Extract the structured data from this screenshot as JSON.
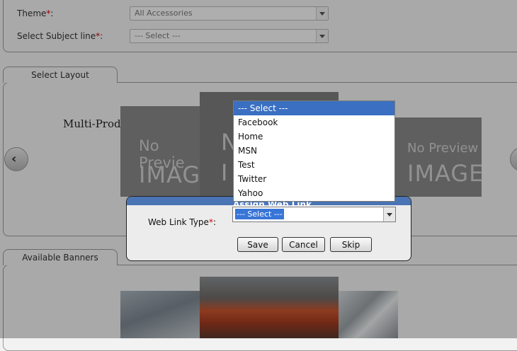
{
  "form": {
    "theme_label": "Theme",
    "theme_value": "All Accessories",
    "subject_label": "Select Subject line",
    "subject_value": "--- Select ---",
    "required_mark": "*",
    "colon": ":"
  },
  "layout_section": {
    "tab_label": "Select Layout",
    "slide_caption": "Multi-Produ",
    "no_preview_line1": "No Previe",
    "no_preview_line2": "IMAG",
    "center_partial_line1": "N",
    "center_partial_line2": "I",
    "right_line1": "No Preview",
    "right_line2": "IMAGE",
    "prev_glyph": "‹"
  },
  "banners_section": {
    "tab_label": "Available Banners"
  },
  "dialog": {
    "title": "Assign Web Link",
    "field_label": "Web Link Type",
    "required_mark": "*",
    "colon": ":",
    "select_value": "--- Select ---",
    "buttons": {
      "save": "Save",
      "cancel": "Cancel",
      "skip": "Skip"
    }
  },
  "dropdown": {
    "options": [
      "--- Select ---",
      "Facebook",
      "Home",
      "MSN",
      "Test",
      "Twitter",
      "Yahoo"
    ],
    "selected_index": 0
  },
  "colors": {
    "dialog_title_bar": "#4a74b4",
    "selected_option": "#3a6fc1",
    "required_mark": "#d40000"
  }
}
